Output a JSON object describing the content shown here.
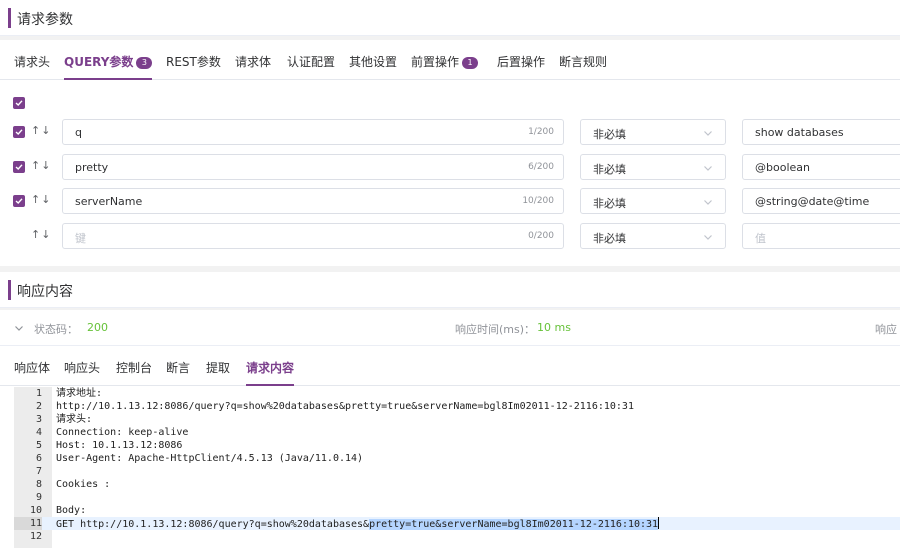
{
  "request_section": {
    "title": "请求参数",
    "tabs": [
      {
        "label": "请求头"
      },
      {
        "label": "QUERY参数",
        "badge": "3"
      },
      {
        "label": "REST参数"
      },
      {
        "label": "请求体"
      },
      {
        "label": "认证配置"
      },
      {
        "label": "其他设置"
      },
      {
        "label": "前置操作",
        "badge": "1"
      },
      {
        "label": "后置操作"
      },
      {
        "label": "断言规则"
      }
    ],
    "rows": [
      {
        "key": "q",
        "count": "1/200",
        "required": "非必填",
        "value": "show databases"
      },
      {
        "key": "pretty",
        "count": "6/200",
        "required": "非必填",
        "value": "@boolean"
      },
      {
        "key": "serverName",
        "count": "10/200",
        "required": "非必填",
        "value": "@string@date@time"
      },
      {
        "key_placeholder": "键",
        "count": "0/200",
        "required": "非必填",
        "value_placeholder": "值"
      }
    ],
    "arrows": "↑↓"
  },
  "response_section": {
    "title": "响应内容",
    "status_label": "状态码：",
    "status_value": "200",
    "time_label": "响应时间(ms)：",
    "time_value": "10 ms",
    "size_label_partial": "响应",
    "tabs": [
      "响应体",
      "响应头",
      "控制台",
      "断言",
      "提取",
      "请求内容"
    ],
    "lines": [
      "请求地址:",
      "http://10.1.13.12:8086/query?q=show%20databases&pretty=true&serverName=bgl8Im02011-12-2116:10:31",
      "请求头:",
      "Connection: keep-alive",
      "Host: 10.1.13.12:8086",
      "User-Agent: Apache-HttpClient/4.5.13 (Java/11.0.14)",
      "",
      "Cookies :",
      "",
      "Body:",
      "GET http://10.1.13.12:8086/query?q=show%20databases&",
      ""
    ],
    "line11_selected": "pretty=true&serverName=bgl8Im02011-12-2116:10:31",
    "line_numbers": [
      "1",
      "2",
      "3",
      "4",
      "5",
      "6",
      "7",
      "8",
      "9",
      "10",
      "11",
      "12"
    ]
  },
  "colors": {
    "accent": "#7b3f8c",
    "success": "#67c23a"
  }
}
